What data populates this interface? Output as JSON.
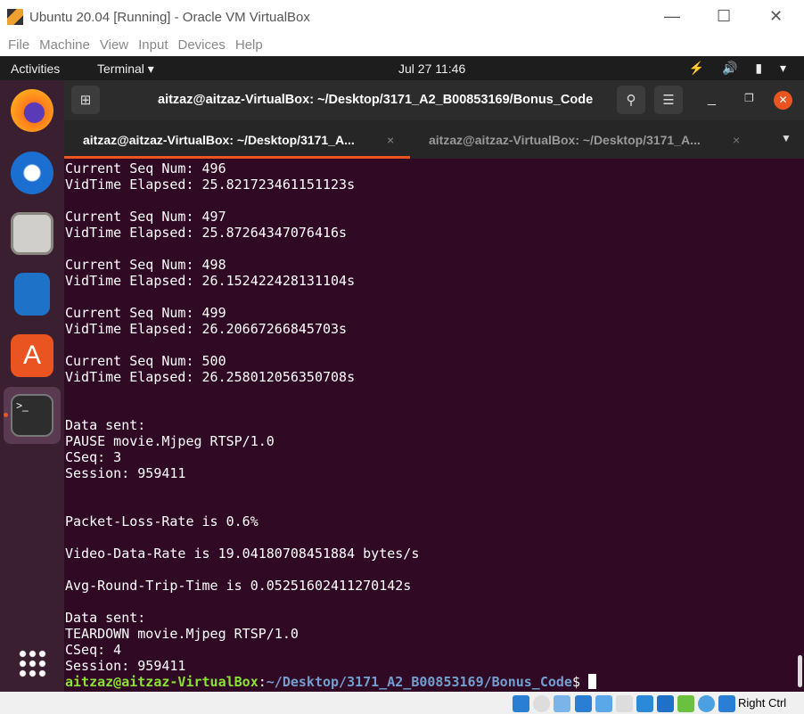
{
  "window": {
    "title": "Ubuntu 20.04 [Running] - Oracle VM VirtualBox",
    "minimize": "—",
    "maximize": "☐",
    "close": "✕"
  },
  "vb_menu": [
    "File",
    "Machine",
    "View",
    "Input",
    "Devices",
    "Help"
  ],
  "topbar": {
    "activities": "Activities",
    "app": "Terminal ▾",
    "clock": "Jul 27  11:46",
    "tray": "⚡ 🔊 ▮ ▾"
  },
  "terminal": {
    "title": "aitzaz@aitzaz-VirtualBox: ~/Desktop/3171_A2_B00853169/Bonus_Code",
    "tabs": [
      {
        "label": "aitzaz@aitzaz-VirtualBox: ~/Desktop/3171_A...",
        "active": true
      },
      {
        "label": "aitzaz@aitzaz-VirtualBox: ~/Desktop/3171_A...",
        "active": false
      }
    ],
    "lines": [
      "Current Seq Num: 496",
      "VidTime Elapsed: 25.821723461151123s",
      "",
      "Current Seq Num: 497",
      "VidTime Elapsed: 25.87264347076416s",
      "",
      "Current Seq Num: 498",
      "VidTime Elapsed: 26.152422428131104s",
      "",
      "Current Seq Num: 499",
      "VidTime Elapsed: 26.20667266845703s",
      "",
      "Current Seq Num: 500",
      "VidTime Elapsed: 26.258012056350708s",
      "",
      "",
      "Data sent:",
      "PAUSE movie.Mjpeg RTSP/1.0",
      "CSeq: 3",
      "Session: 959411",
      "",
      "",
      "Packet-Loss-Rate is 0.6%",
      "",
      "Video-Data-Rate is 19.04180708451884 bytes/s",
      "",
      "Avg-Round-Trip-Time is 0.05251602411270142s",
      "",
      "Data sent:",
      "TEARDOWN movie.Mjpeg RTSP/1.0",
      "CSeq: 4",
      "Session: 959411"
    ],
    "prompt_user": "aitzaz@aitzaz-VirtualBox",
    "prompt_colon": ":",
    "prompt_path": "~/Desktop/3171_A2_B00853169/Bonus_Code",
    "prompt_sign": "$"
  },
  "statusbar": {
    "host_key": "Right Ctrl"
  }
}
